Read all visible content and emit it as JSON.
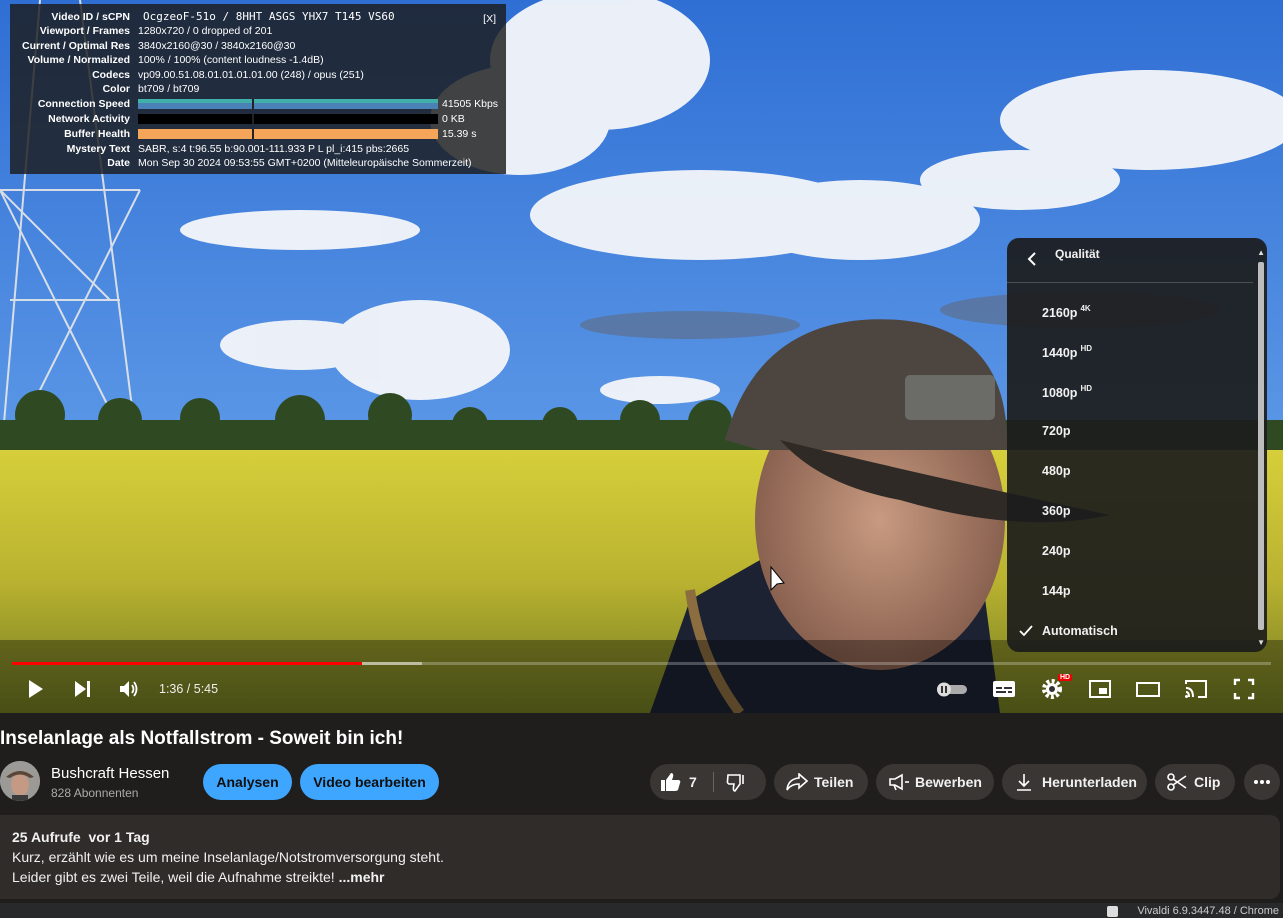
{
  "stats": {
    "rows": [
      {
        "label": "Video ID / sCPN",
        "value": "OcgzeoF-51o / 8HHT ASGS YHX7 T145 VS60"
      },
      {
        "label": "Viewport / Frames",
        "value": "1280x720 / 0 dropped of 201"
      },
      {
        "label": "Current / Optimal Res",
        "value": "3840x2160@30 / 3840x2160@30"
      },
      {
        "label": "Volume / Normalized",
        "value": "100% / 100% (content loudness -1.4dB)"
      },
      {
        "label": "Codecs",
        "value": "vp09.00.51.08.01.01.01.01.00 (248) / opus (251)"
      },
      {
        "label": "Color",
        "value": "bt709 / bt709"
      },
      {
        "label": "Connection Speed",
        "value": "41505 Kbps"
      },
      {
        "label": "Network Activity",
        "value": "0 KB"
      },
      {
        "label": "Buffer Health",
        "value": "15.39 s"
      },
      {
        "label": "Mystery Text",
        "value": "SABR, s:4 t:96.55 b:90.001-111.933 P L pl_i:415 pbs:2665"
      },
      {
        "label": "Date",
        "value": "Mon Sep 30 2024 09:53:55 GMT+0200 (Mitteleuropäische Sommerzeit)"
      }
    ],
    "close_label": "[X]",
    "colors": {
      "connection": "#3aa8a0",
      "network": "#000000",
      "buffer": "#f5a55a"
    }
  },
  "quality_menu": {
    "title": "Qualität",
    "options": [
      {
        "label": "2160p",
        "badge": "4K"
      },
      {
        "label": "1440p",
        "badge": "HD"
      },
      {
        "label": "1080p",
        "badge": "HD"
      },
      {
        "label": "720p",
        "badge": ""
      },
      {
        "label": "480p",
        "badge": ""
      },
      {
        "label": "360p",
        "badge": ""
      },
      {
        "label": "240p",
        "badge": ""
      },
      {
        "label": "144p",
        "badge": ""
      },
      {
        "label": "Automatisch",
        "badge": ""
      }
    ],
    "selected": "Automatisch"
  },
  "player": {
    "time": "1:36 / 5:45",
    "played_fraction": 0.278,
    "buffered_fraction": 0.326,
    "settings_badge": "HD",
    "accent_color": "#ff0000"
  },
  "video": {
    "title": "Inselanlage als Notfallstrom - Soweit bin ich!",
    "channel": "Bushcraft Hessen",
    "subscribers": "828 Abonnenten",
    "buttons": {
      "analytics": "Analysen",
      "edit": "Video bearbeiten",
      "likes": "7",
      "share": "Teilen",
      "promote": "Bewerben",
      "download": "Herunterladen",
      "clip": "Clip"
    },
    "description": {
      "meta": "25 Aufrufe  vor 1 Tag",
      "line1": "Kurz, erzählt wie es um meine Inselanlage/Notstromversorgung steht.",
      "line2": "Leider gibt es zwei Teile, weil die Aufnahme streikte! ",
      "more": "...mehr"
    }
  },
  "browser": {
    "status": "Vivaldi 6.9.3447.48 / Chrome"
  }
}
